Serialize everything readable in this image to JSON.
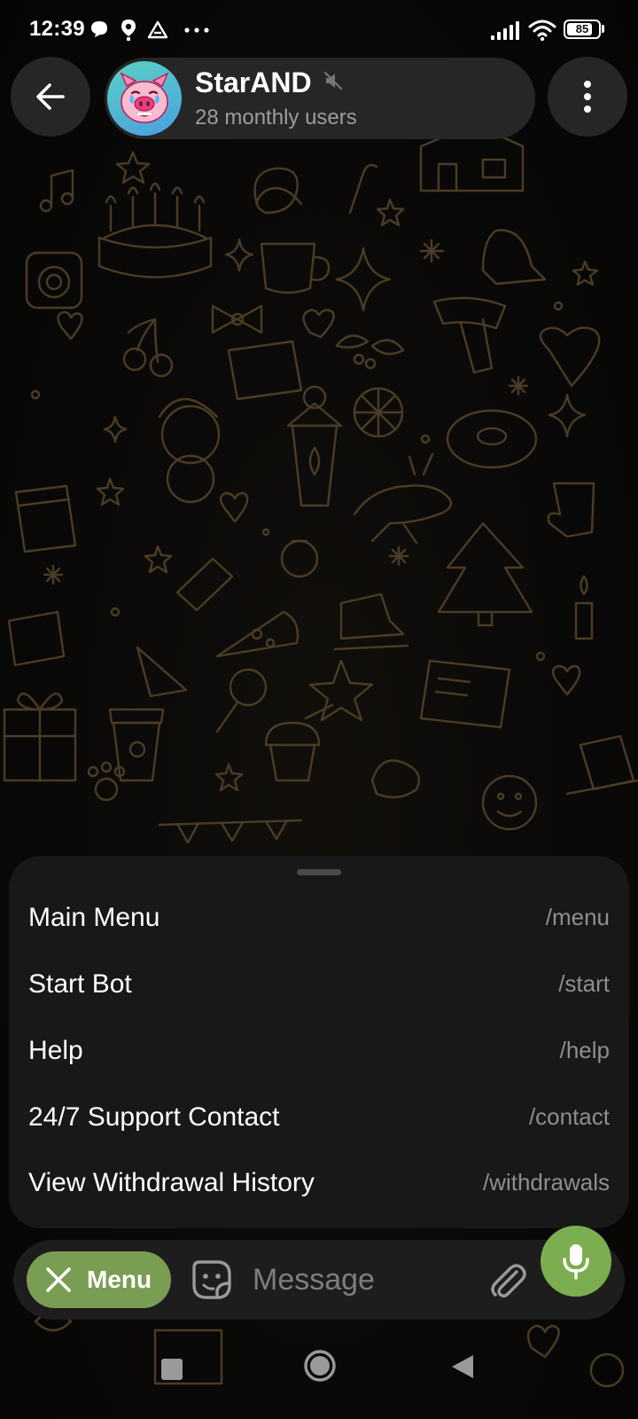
{
  "status_bar": {
    "time": "12:39",
    "battery": "85",
    "battery_level": 0.85,
    "icons": [
      "chat-bubble-icon",
      "location-icon",
      "drive-icon",
      "more-dots-icon",
      "signal-icon",
      "wifi-icon",
      "battery-icon"
    ]
  },
  "header": {
    "title": "StarAND",
    "subtitle": "28 monthly users",
    "muted": true
  },
  "commands": [
    {
      "label": "Main Menu",
      "command": "/menu"
    },
    {
      "label": "Start Bot",
      "command": "/start"
    },
    {
      "label": "Help",
      "command": "/help"
    },
    {
      "label": "24/7 Support Contact",
      "command": "/contact"
    },
    {
      "label": "View Withdrawal History",
      "command": "/withdrawals"
    }
  ],
  "input_bar": {
    "menu_label": "Menu",
    "message_placeholder": "Message"
  },
  "colors": {
    "menu_button": "#7a9d54",
    "mic_button": "#7cae4f",
    "panel_background": "#181818",
    "wallpaper_doodle": "#4a3b24"
  }
}
